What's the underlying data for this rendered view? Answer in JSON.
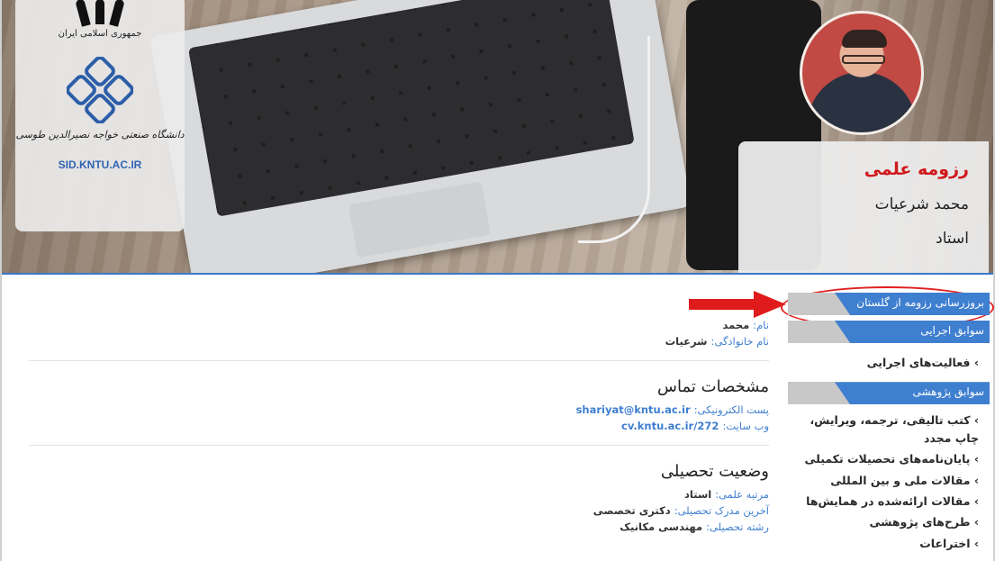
{
  "header": {
    "logo_top_text": "جمهوری اسلامی ایران",
    "logo_university": "دانشگاه صنعتی خواجه نصیرالدین طوسی",
    "logo_site": "SID.KNTU.AC.IR",
    "resume_title": "رزومه علمی",
    "person_name": "محمد شرعیات",
    "person_rank": "استاد",
    "colors": {
      "accent": "#3f7fd0",
      "title_red": "#d0181c"
    }
  },
  "sidebar": {
    "update_from_golestan": "بروزرسانی رزومه از گلستان",
    "exec_section": "سوابق اجرایی",
    "exec_items": [
      "› فعالیت‌های اجرایی"
    ],
    "research_section": "سوابق پژوهشی",
    "research_items": [
      "› کتب تالیفی، ترجمه، ویرایش، چاپ مجدد",
      "› پایان‌نامه‌های تحصیلات تکمیلی",
      "› مقالات ملی و بین المللی",
      "› مقالات ارائه‌شده در همایش‌ها",
      "› طرح‌های پژوهشی",
      "› اختراعات"
    ]
  },
  "personal": {
    "first_name_label": "نام:",
    "first_name": "محمد",
    "last_name_label": "نام خانوادگی:",
    "last_name": "شرعیات"
  },
  "contact": {
    "heading": "مشخصات تماس",
    "email_label": "پست الکترونیکی:",
    "email": "shariyat@kntu.ac.ir",
    "website_label": "وب سایت:",
    "website": "cv.kntu.ac.ir/272"
  },
  "education": {
    "heading": "وضعیت تحصیلی",
    "rank_label": "مرتبه علمی:",
    "rank": "استاد",
    "degree_label": "آخرین مدرک تحصیلی:",
    "degree": "دکتری تخصصی",
    "field_label": "رشته تحصیلی:",
    "field": "مهندسی مکانیک"
  }
}
